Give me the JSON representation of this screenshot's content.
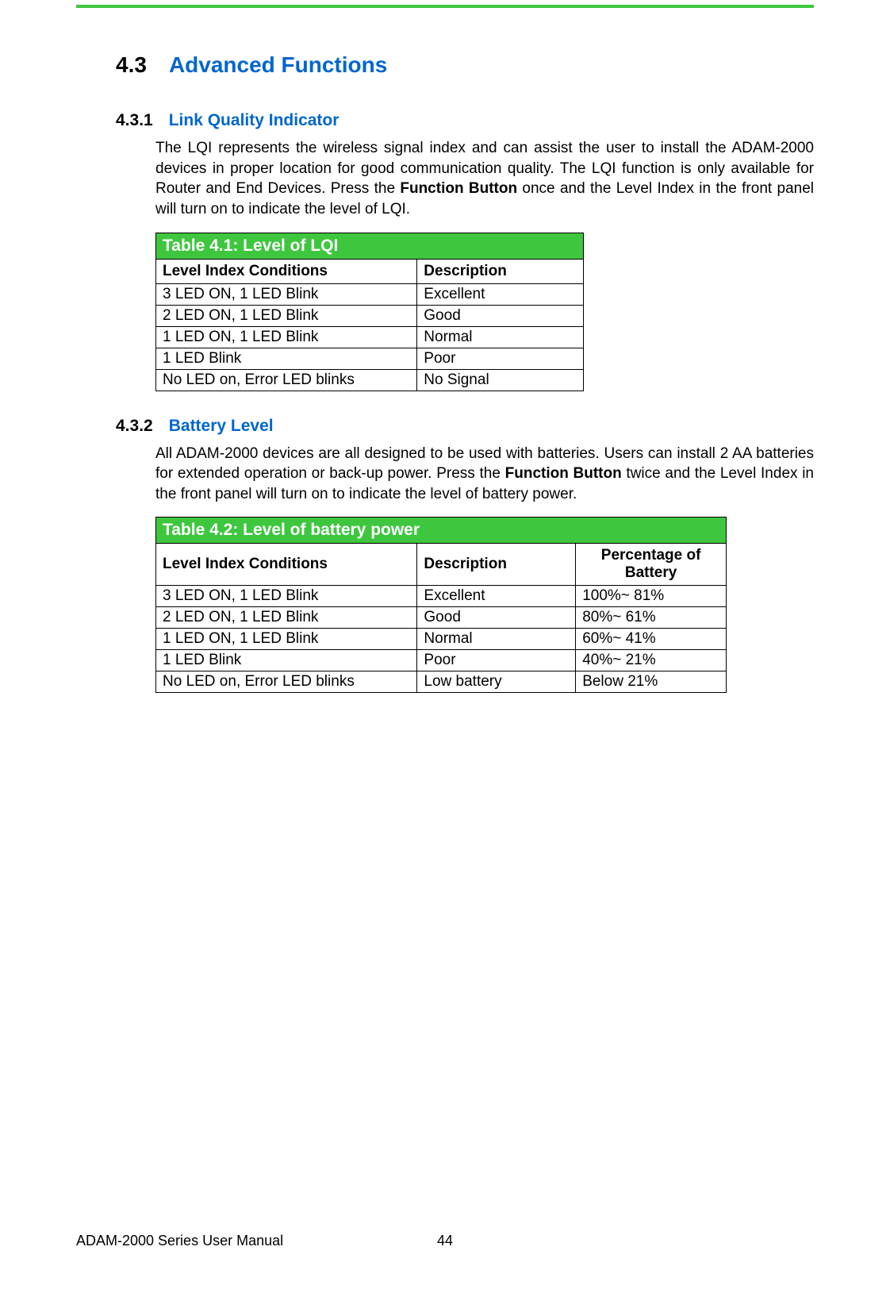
{
  "section": {
    "number": "4.3",
    "title": "Advanced Functions"
  },
  "subsection1": {
    "number": "4.3.1",
    "title": "Link Quality Indicator",
    "para_part1": "The LQI represents the wireless signal index and can assist the user to install the ADAM-2000 devices in proper location for good communication quality. The LQI function is only available for Router and End Devices. Press the ",
    "para_bold": "Function Button",
    "para_part2": " once and the Level Index in the front panel will turn on to indicate the level of LQI."
  },
  "table1": {
    "title": "Table 4.1: Level of LQI",
    "headers": [
      "Level Index Conditions",
      "Description"
    ],
    "rows": [
      [
        "3 LED ON, 1 LED Blink",
        "Excellent"
      ],
      [
        "2 LED ON, 1 LED Blink",
        "Good"
      ],
      [
        "1 LED ON, 1 LED Blink",
        "Normal"
      ],
      [
        "1 LED Blink",
        "Poor"
      ],
      [
        "No LED on, Error LED blinks",
        "No Signal"
      ]
    ]
  },
  "subsection2": {
    "number": "4.3.2",
    "title": "Battery Level",
    "para_part1": "All ADAM-2000 devices are all designed to be used with batteries. Users can install 2 AA batteries for extended operation or back-up power. Press the ",
    "para_bold": "Function Button",
    "para_part2": " twice and the Level Index in the front panel will turn on to indicate the level of battery power."
  },
  "table2": {
    "title": "Table 4.2: Level of battery power",
    "headers": [
      "Level Index Conditions",
      "Description",
      "Percentage of Battery"
    ],
    "rows": [
      [
        "3 LED ON, 1 LED Blink",
        "Excellent",
        "100%~ 81%"
      ],
      [
        "2 LED ON, 1 LED Blink",
        "Good",
        "80%~ 61%"
      ],
      [
        "1 LED ON, 1 LED Blink",
        "Normal",
        "60%~ 41%"
      ],
      [
        "1 LED Blink",
        "Poor",
        "40%~ 21%"
      ],
      [
        "No LED on, Error LED blinks",
        "Low battery",
        "Below 21%"
      ]
    ]
  },
  "footer": {
    "manual": "ADAM-2000 Series User Manual",
    "page": "44"
  }
}
